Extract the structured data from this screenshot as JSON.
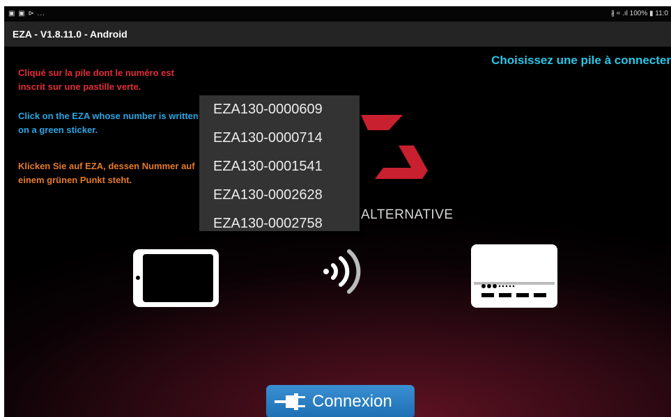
{
  "status_bar": {
    "left_icons": "▣ ▣ ⊳ ...",
    "right_text": "∦ ≈ .ıl 100% ▮ 11:0"
  },
  "app": {
    "title": "EZA - V1.8.11.0 - Android"
  },
  "main": {
    "heading": "Choisissez une pile à connecter",
    "instructions": {
      "fr": "Cliqué sur la pile dont le numéro est inscrit sur une pastille verte.",
      "en": "Click on the EZA whose number is written on a green sticker.",
      "de": "Klicken Sie auf EZA, dessen Nummer auf einem grünen Punkt steht."
    },
    "logo_text": "ALTERNATIVE",
    "devices": [
      "EZA130-0000609",
      "EZA130-0000714",
      "EZA130-0001541",
      "EZA130-0002628",
      "EZA130-0002758"
    ],
    "connect_label": "Connexion"
  },
  "colors": {
    "heading": "#29c6e8",
    "french_text": "#e22d3b",
    "english_text": "#2aa6e3",
    "german_text": "#e67a27",
    "button": "#2a7fc4",
    "logo_red": "#c8202e"
  },
  "icons": [
    "tablet-icon",
    "wireless-signal-icon",
    "battery-device-icon",
    "plug-icon"
  ]
}
